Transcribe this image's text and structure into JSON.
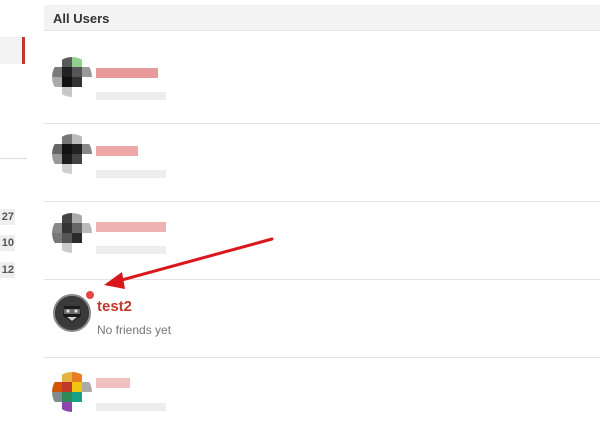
{
  "panel": {
    "title": "All Users"
  },
  "sidebar": {
    "counts": [
      "27",
      "10",
      "12"
    ]
  },
  "users": [
    {
      "name": "test2",
      "subtitle": "No friends yet",
      "online": true
    }
  ],
  "colors": {
    "accent": "#c0392b",
    "online": "#e84545",
    "arrow": "#d9161c"
  }
}
